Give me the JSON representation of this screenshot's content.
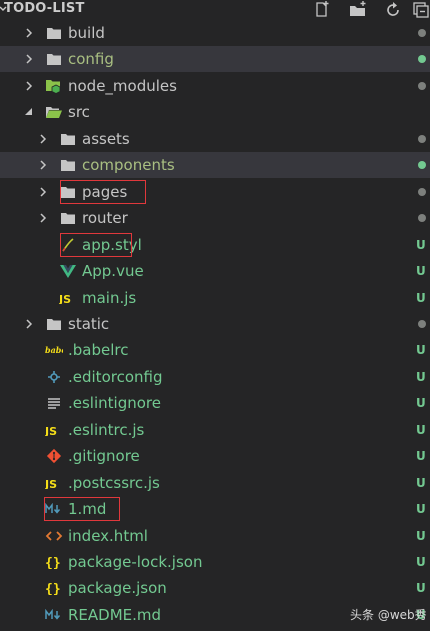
{
  "header": {
    "title": "TODO-LIST"
  },
  "colors": {
    "background": "#252526",
    "selected_row": "#37373d",
    "folder_text": "#c5c5c5",
    "modified_text": "#a9bf82",
    "untracked_text": "#73c991",
    "highlight_box": "#e0383c",
    "dot_gray": "#7d807d",
    "dot_green": "#73c991"
  },
  "tree": [
    {
      "label": "build",
      "icon": "folder-icon",
      "type": "folder",
      "expanded": false,
      "depth": 0
    },
    {
      "label": "config",
      "icon": "folder-icon",
      "type": "folder",
      "expanded": false,
      "depth": 0,
      "selected": true
    },
    {
      "label": "node_modules",
      "icon": "node-modules-folder-icon",
      "type": "folder",
      "expanded": false,
      "depth": 0
    },
    {
      "label": "src",
      "icon": "src-folder-open-icon",
      "type": "folder",
      "expanded": true,
      "depth": 0
    },
    {
      "label": "assets",
      "icon": "folder-icon",
      "type": "folder",
      "expanded": false,
      "depth": 1
    },
    {
      "label": "components",
      "icon": "folder-icon",
      "type": "folder",
      "expanded": false,
      "depth": 1,
      "selected": true
    },
    {
      "label": "pages",
      "icon": "folder-icon",
      "type": "folder",
      "expanded": false,
      "depth": 1,
      "highlighted": true
    },
    {
      "label": "router",
      "icon": "folder-icon",
      "type": "folder",
      "expanded": false,
      "depth": 1
    },
    {
      "label": "app.styl",
      "icon": "stylus-icon",
      "type": "file",
      "depth": 1,
      "badge": "U",
      "highlighted": true
    },
    {
      "label": "App.vue",
      "icon": "vue-icon",
      "type": "file",
      "depth": 1,
      "badge": "U"
    },
    {
      "label": "main.js",
      "icon": "js-icon",
      "type": "file",
      "depth": 1,
      "badge": "U"
    },
    {
      "label": "static",
      "icon": "folder-icon",
      "type": "folder",
      "expanded": false,
      "depth": 0
    },
    {
      "label": ".babelrc",
      "icon": "babel-icon",
      "type": "file",
      "depth": 0,
      "badge": "U"
    },
    {
      "label": ".editorconfig",
      "icon": "editorconfig-icon",
      "type": "file",
      "depth": 0,
      "badge": "U"
    },
    {
      "label": ".eslintignore",
      "icon": "lines-icon",
      "type": "file",
      "depth": 0,
      "badge": "U"
    },
    {
      "label": ".eslintrc.js",
      "icon": "js-icon",
      "type": "file",
      "depth": 0,
      "badge": "U"
    },
    {
      "label": ".gitignore",
      "icon": "git-icon",
      "type": "file",
      "depth": 0,
      "badge": "U"
    },
    {
      "label": ".postcssrc.js",
      "icon": "js-icon",
      "type": "file",
      "depth": 0,
      "badge": "U"
    },
    {
      "label": "1.md",
      "icon": "markdown-icon",
      "type": "file",
      "depth": 0,
      "badge": "U",
      "highlighted": true
    },
    {
      "label": "index.html",
      "icon": "html-icon",
      "type": "file",
      "depth": 0,
      "badge": "U"
    },
    {
      "label": "package-lock.json",
      "icon": "json-icon",
      "type": "file",
      "depth": 0,
      "badge": "U"
    },
    {
      "label": "package.json",
      "icon": "json-icon",
      "type": "file",
      "depth": 0,
      "badge": "U"
    },
    {
      "label": "README.md",
      "icon": "markdown-icon",
      "type": "file",
      "depth": 0,
      "badge": "U"
    }
  ],
  "watermark": "头条 @web秀"
}
